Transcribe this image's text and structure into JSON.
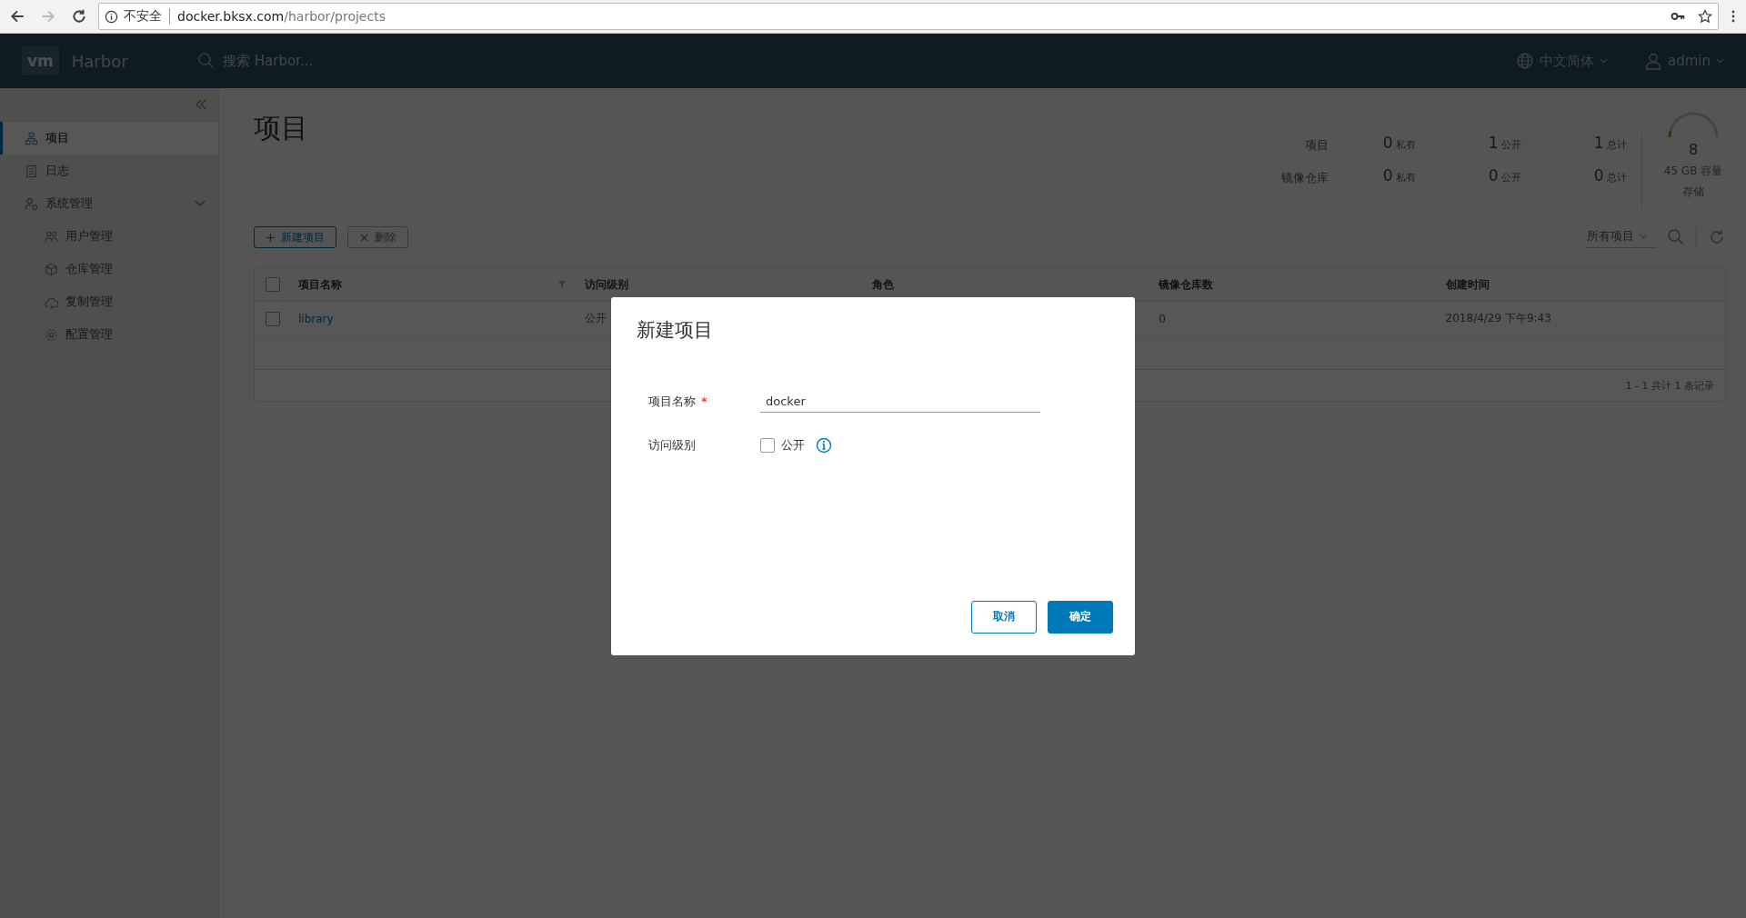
{
  "browser": {
    "security_label": "不安全",
    "url_host": "docker.bksx.com",
    "url_path": "/harbor/projects",
    "forward_disabled": true
  },
  "header": {
    "logo": "vm",
    "brand": "Harbor",
    "search_placeholder": "搜索 Harbor...",
    "language": "中文简体",
    "user": "admin"
  },
  "sidebar": {
    "items": [
      {
        "label": "项目",
        "kind": "projects",
        "selected": true
      },
      {
        "label": "日志",
        "kind": "logs",
        "selected": false
      },
      {
        "label": "系统管理",
        "kind": "admin",
        "selected": false,
        "expanded": true,
        "children": [
          {
            "label": "用户管理",
            "kind": "users",
            "selected": false
          },
          {
            "label": "仓库管理",
            "kind": "registries",
            "selected": false
          },
          {
            "label": "复制管理",
            "kind": "replication",
            "selected": false
          },
          {
            "label": "配置管理",
            "kind": "config",
            "selected": false
          }
        ]
      }
    ]
  },
  "page": {
    "title": "项目",
    "stats": [
      {
        "label": "项目",
        "private": "0",
        "private_label": "私有",
        "public": "1",
        "public_label": "公开",
        "total": "1",
        "total_label": "总计"
      },
      {
        "label": "镜像仓库",
        "private": "0",
        "private_label": "私有",
        "public": "0",
        "public_label": "公开",
        "total": "0",
        "total_label": "总计"
      }
    ],
    "storage": {
      "count": "8",
      "capacity": "45 GB 容量",
      "label": "存储",
      "level": 0.08
    },
    "new_button": "新建项目",
    "delete_button": {
      "label": "删除",
      "disabled": true
    },
    "filter": "所有项目"
  },
  "table": {
    "all_checked": false,
    "columns": [
      {
        "label": "项目名称",
        "filter": true
      },
      {
        "label": "访问级别",
        "filter": false
      },
      {
        "label": "角色",
        "filter": false
      },
      {
        "label": "镜像仓库数",
        "filter": false
      },
      {
        "label": "创建时间",
        "filter": false
      }
    ],
    "rows": [
      {
        "checked": false,
        "name": "library",
        "access": "公开",
        "repo_count": "0",
        "created": "2018/4/29 下午9:43"
      }
    ],
    "footer": "1 - 1 共计 1 条记录"
  },
  "dialog": {
    "title": "新建项目",
    "name_label": "项目名称",
    "required_mark": "*",
    "name_value": "docker",
    "access_label": "访问级别",
    "public_label": "公开",
    "public_checked": false,
    "cancel": "取消",
    "ok": "确定"
  }
}
